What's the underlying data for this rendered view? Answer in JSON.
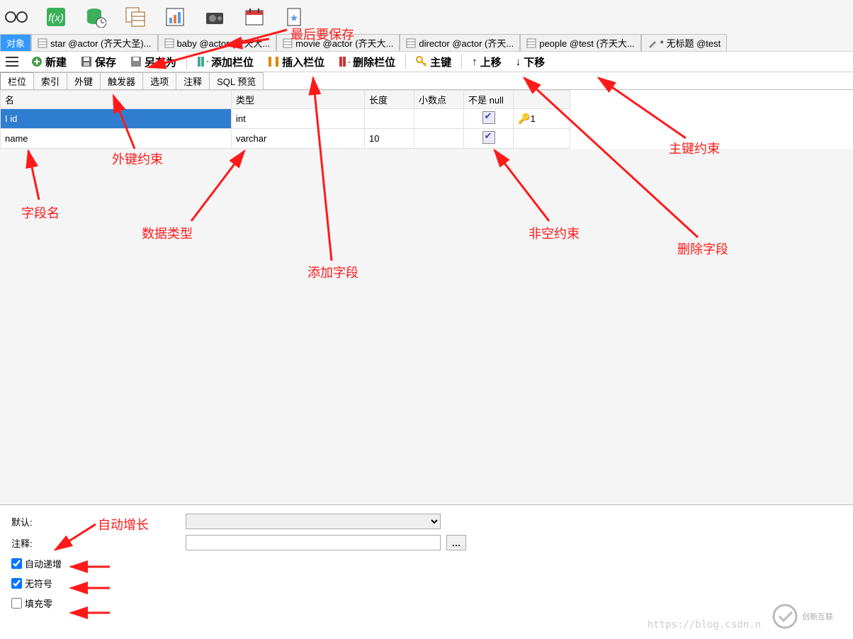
{
  "doc_tabs": {
    "object": "对象",
    "star": "star @actor (齐天大圣)...",
    "baby": "baby @actor (齐天大...",
    "movie": "movie @actor (齐天大...",
    "director": "director @actor (齐天...",
    "people": "people @test (齐天大...",
    "untitled": "* 无标题 @test"
  },
  "actions": {
    "new": "新建",
    "save": "保存",
    "saveas": "另存为",
    "add_col": "添加栏位",
    "insert_col": "插入栏位",
    "delete_col": "删除栏位",
    "primary_key": "主键",
    "move_up": "上移",
    "move_down": "下移"
  },
  "sub_tabs": {
    "cols": "栏位",
    "idx": "索引",
    "fk": "外键",
    "trig": "触发器",
    "opt": "选项",
    "comment": "注释",
    "sql": "SQL 预览"
  },
  "grid_headers": {
    "name": "名",
    "type": "类型",
    "len": "长度",
    "dec": "小数点",
    "notnull": "不是 null"
  },
  "rows": {
    "r1": {
      "name": "id",
      "type": "int",
      "len": "",
      "dec": "",
      "notnull": true,
      "key": "1"
    },
    "r2": {
      "name": "name",
      "type": "varchar",
      "len": "10",
      "dec": "",
      "notnull": true,
      "key": ""
    }
  },
  "lower": {
    "default": "默认:",
    "comment": "注释:",
    "autoinc": "自动递增",
    "unsigned": "无符号",
    "zerofill": "填充零"
  },
  "annotations": {
    "save_last": "最后要保存",
    "fk_constraint": "外键约束",
    "field_name": "字段名",
    "data_type": "数据类型",
    "add_field": "添加字段",
    "notnull_constraint": "非空约束",
    "delete_field": "删除字段",
    "pk_constraint": "主键约束",
    "auto_growth": "自动增长"
  },
  "watermark": "https://blog.csdn.n",
  "logo_text": "创新互联"
}
